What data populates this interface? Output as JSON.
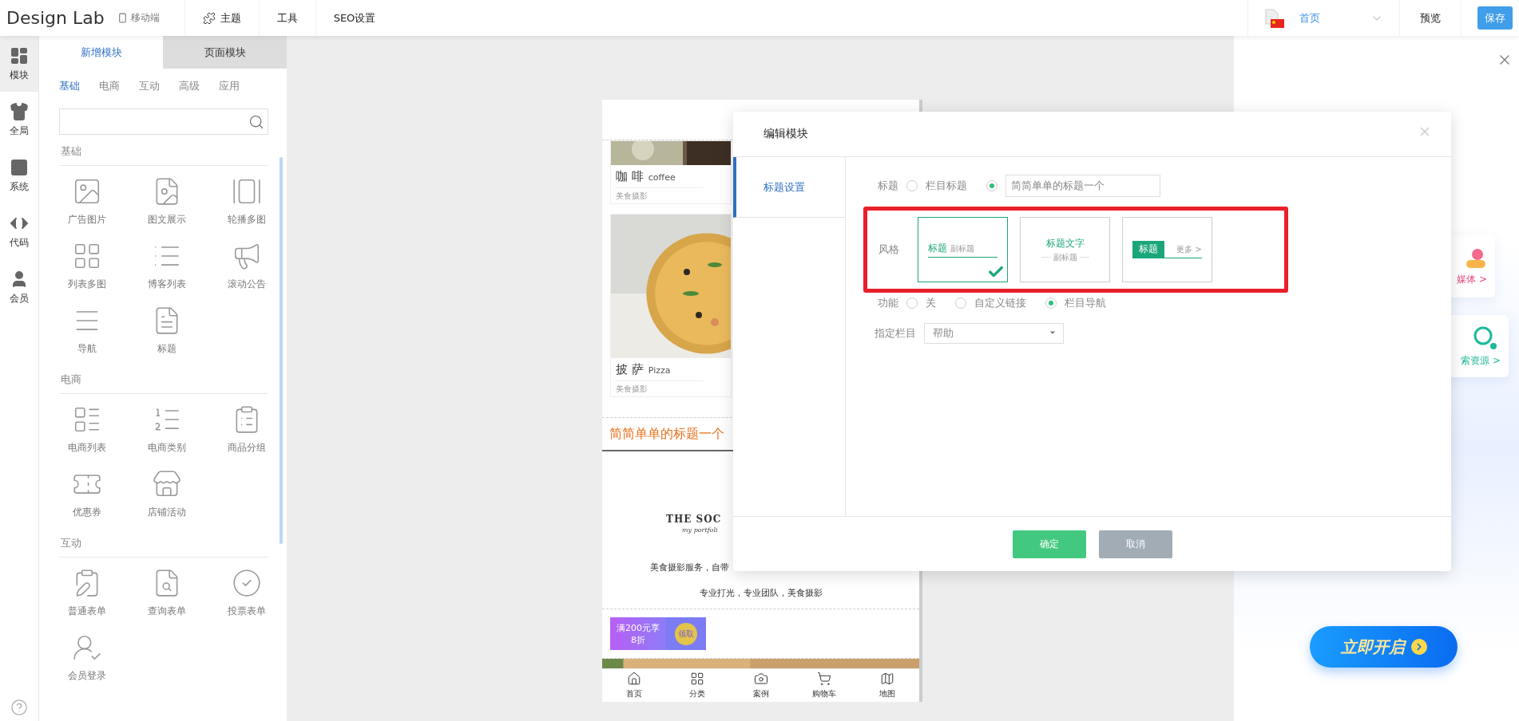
{
  "topbar": {
    "logo": "Design Lab",
    "device": "移动端",
    "nav": [
      {
        "label": "主题",
        "kind": "icon"
      },
      {
        "label": "工具",
        "kind": "plain"
      },
      {
        "label": "SEO设置",
        "kind": "plain"
      }
    ],
    "page_select": {
      "value": "首页"
    },
    "preview": "预览",
    "save": "保存"
  },
  "rail": [
    {
      "label": "模块",
      "selected": true
    },
    {
      "label": "全局",
      "selected": false
    },
    {
      "label": "系统",
      "selected": false
    },
    {
      "label": "代码",
      "selected": false
    },
    {
      "label": "会员",
      "selected": false
    }
  ],
  "panel": {
    "tabs": [
      {
        "label": "新增模块",
        "selected": true
      },
      {
        "label": "页面模块",
        "selected": false
      }
    ],
    "categories": [
      {
        "label": "基础",
        "selected": true
      },
      {
        "label": "电商",
        "selected": false
      },
      {
        "label": "互动",
        "selected": false
      },
      {
        "label": "高级",
        "selected": false
      },
      {
        "label": "应用",
        "selected": false
      }
    ],
    "sections": [
      {
        "title": "基础",
        "items": [
          {
            "label": "广告图片"
          },
          {
            "label": "图文展示"
          },
          {
            "label": "轮播多图"
          },
          {
            "label": "列表多图"
          },
          {
            "label": "博客列表"
          },
          {
            "label": "滚动公告"
          },
          {
            "label": "导航"
          },
          {
            "label": "标题"
          }
        ]
      },
      {
        "title": "电商",
        "items": [
          {
            "label": "电商列表"
          },
          {
            "label": "电商类别"
          },
          {
            "label": "商品分组"
          },
          {
            "label": "优惠券"
          },
          {
            "label": "店铺活动"
          }
        ]
      },
      {
        "title": "互动",
        "items": [
          {
            "label": "普通表单"
          },
          {
            "label": "查询表单"
          },
          {
            "label": "投票表单"
          },
          {
            "label": "会员登录"
          }
        ]
      }
    ]
  },
  "phone": {
    "products": [
      {
        "name": "咖 啡",
        "name_en": "coffee",
        "note": "美食摄影"
      },
      {
        "name": "披 萨",
        "name_en": "Pizza",
        "note": "美食摄影"
      }
    ],
    "title_bar": "简简单单的标题一个",
    "brand": "THE SOC",
    "brand_sub": "my portfoli",
    "text_1": "美食摄影服务，自带",
    "text_2": "专业打光，专业团队，美食摄影",
    "coupon": {
      "offer": "满200元享",
      "discount": "8折",
      "action": "领取"
    },
    "nav": [
      {
        "label": "首页"
      },
      {
        "label": "分类"
      },
      {
        "label": "案例"
      },
      {
        "label": "购物车"
      },
      {
        "label": "地图"
      }
    ]
  },
  "promo": {
    "cards": [
      {
        "label": "媒体 >",
        "color": "#e8457a"
      },
      {
        "label": "索资源 >",
        "color": "#1cb99a"
      }
    ],
    "cta": "立即开启"
  },
  "dialog": {
    "title": "编辑模块",
    "nav": [
      {
        "label": "标题设置",
        "selected": true
      }
    ],
    "title_row": {
      "label": "标题",
      "options": [
        {
          "kind": "text",
          "label": "栏目标题",
          "selected": false
        },
        {
          "kind": "input",
          "value": "简简单单的标题一个",
          "selected": true
        }
      ]
    },
    "style_row": {
      "label": "风格",
      "highlighted": true,
      "options": [
        {
          "kind": "underline",
          "title": "标题",
          "subtitle": "副标题",
          "selected": true
        },
        {
          "kind": "centered",
          "title": "标题文字",
          "subtitle": "副标题",
          "selected": false
        },
        {
          "kind": "bar",
          "title": "标题",
          "subtitle": "更多 >",
          "selected": false
        }
      ]
    },
    "function_row": {
      "label": "功能",
      "options": [
        {
          "label": "关",
          "selected": false
        },
        {
          "label": "自定义链接",
          "selected": false
        },
        {
          "label": "栏目导航",
          "selected": true
        }
      ]
    },
    "column_row": {
      "label": "指定栏目",
      "value": "帮助"
    },
    "buttons": [
      {
        "label": "确定",
        "kind": "primary"
      },
      {
        "label": "取消",
        "kind": "secondary"
      }
    ]
  }
}
